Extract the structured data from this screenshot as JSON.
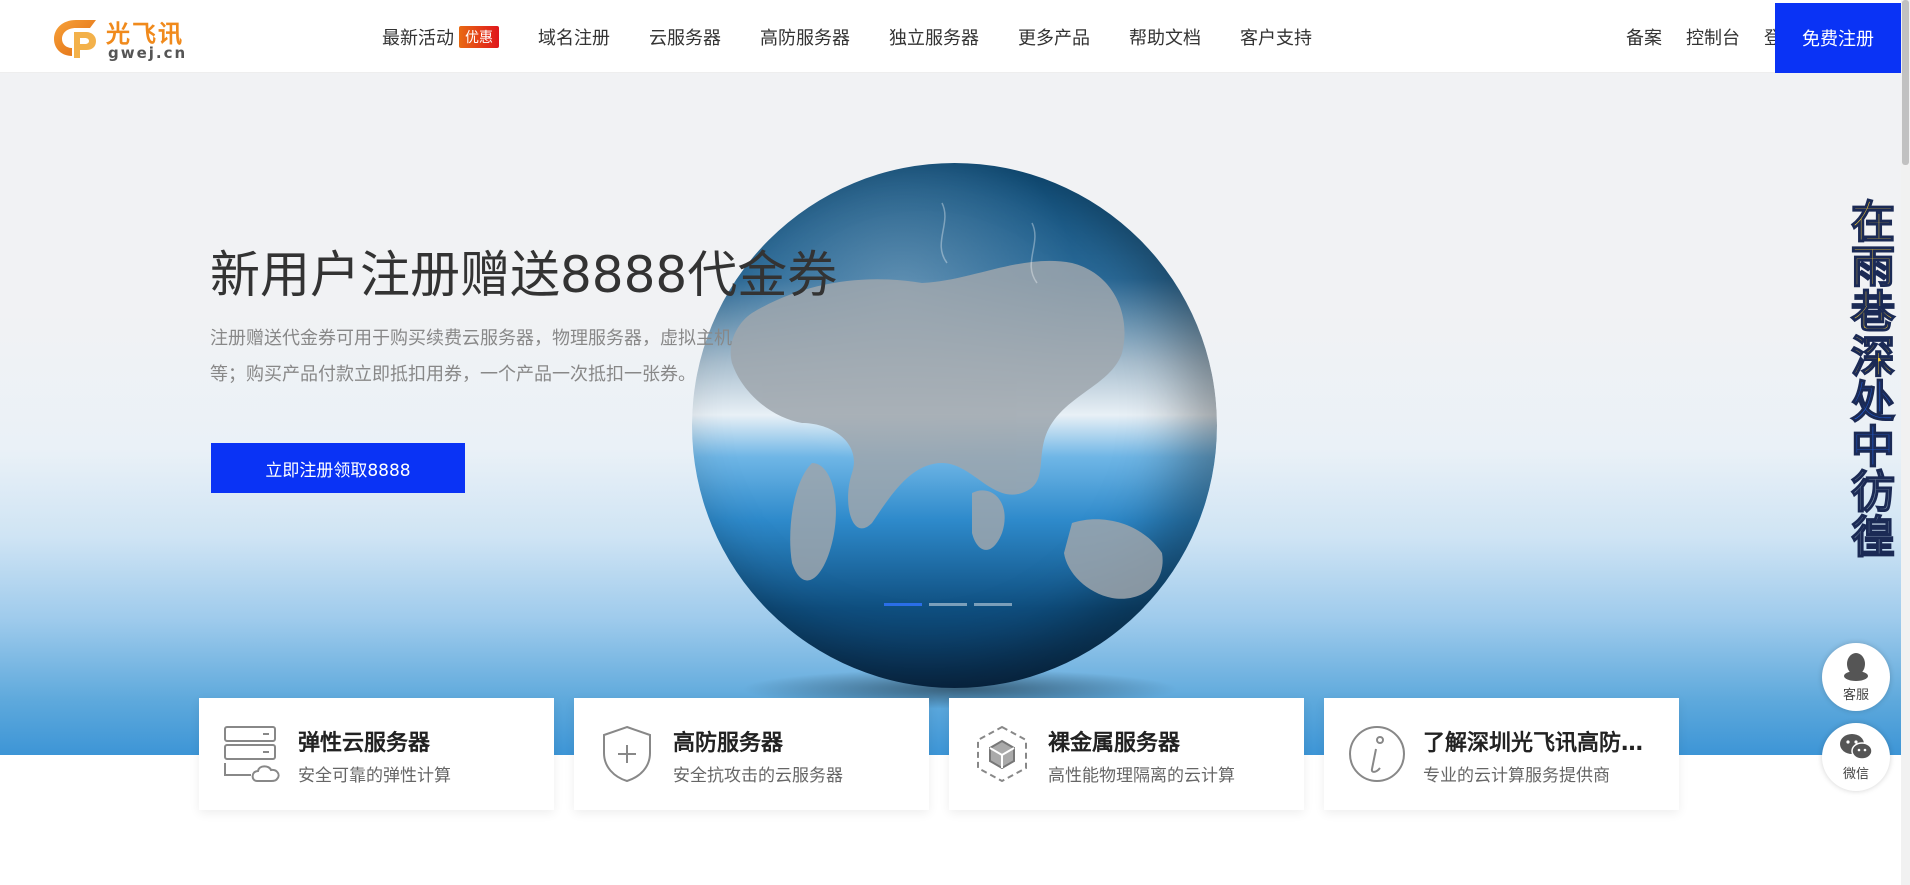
{
  "header": {
    "logo_cn": "光飞讯",
    "logo_en": "gwej.cn",
    "nav": [
      {
        "label": "最新活动",
        "badge": "优惠"
      },
      {
        "label": "域名注册"
      },
      {
        "label": "云服务器"
      },
      {
        "label": "高防服务器"
      },
      {
        "label": "独立服务器"
      },
      {
        "label": "更多产品"
      },
      {
        "label": "帮助文档"
      },
      {
        "label": "客户支持"
      }
    ],
    "right_links": [
      "备案",
      "控制台",
      "登录"
    ],
    "register_label": "免费注册"
  },
  "hero": {
    "title": "新用户注册赠送8888代金券",
    "desc_line1": "注册赠送代金券可用于购买续费云服务器，物理服务器，虚拟主机",
    "desc_line2": "等；购买产品付款立即抵扣用券，一个产品一次抵扣一张券。",
    "cta_label": "立即注册领取8888"
  },
  "vertical_banner": [
    "在",
    "雨",
    "巷",
    "深",
    "处",
    "中",
    "彷",
    "徨"
  ],
  "side_buttons": [
    {
      "label": "客服",
      "icon": "qq-icon"
    },
    {
      "label": "微信",
      "icon": "wechat-icon"
    }
  ],
  "cards": [
    {
      "title": "弹性云服务器",
      "subtitle": "安全可靠的弹性计算",
      "icon": "server-cloud-icon"
    },
    {
      "title": "高防服务器",
      "subtitle": "安全抗攻击的云服务器",
      "icon": "shield-plus-icon"
    },
    {
      "title": "裸金属服务器",
      "subtitle": "高性能物理隔离的云计算",
      "icon": "cube-icon"
    },
    {
      "title": "了解深圳光飞讯高防服务器",
      "subtitle": "专业的云计算服务提供商",
      "icon": "info-icon"
    }
  ],
  "colors": {
    "primary": "#0a33f5",
    "badge": "#e0161c",
    "logo": "#f08a1c"
  }
}
